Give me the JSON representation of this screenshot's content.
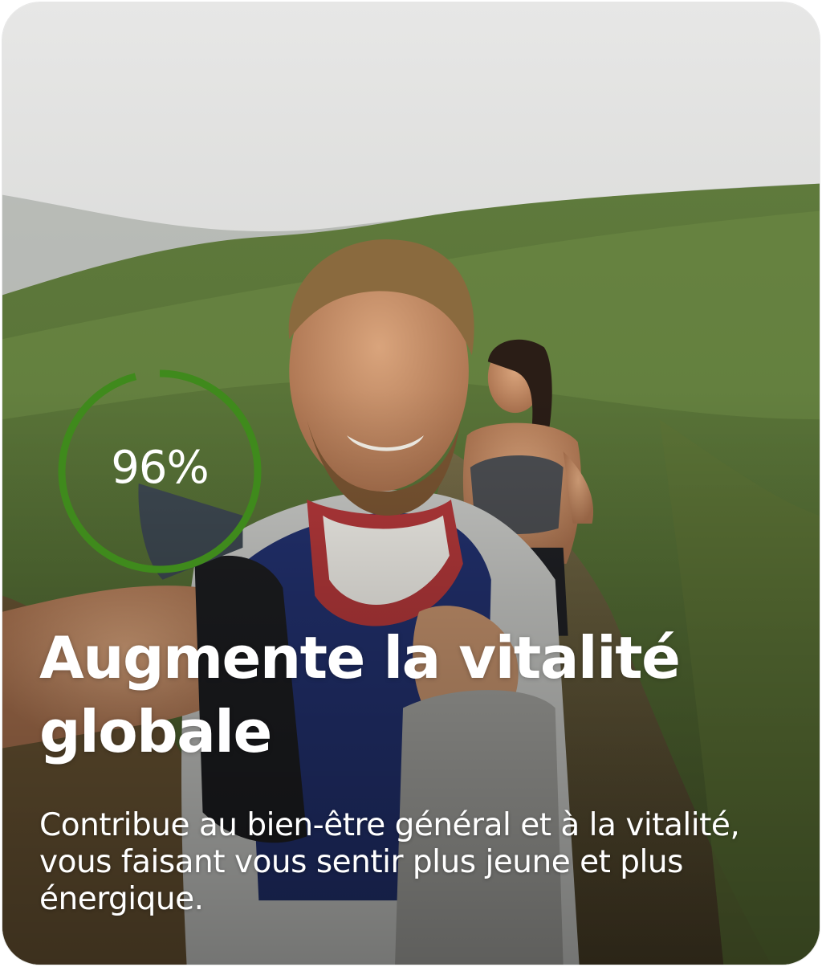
{
  "card": {
    "progress": {
      "value": 0.96,
      "label": "96%",
      "ring_color": "#3f8a1c"
    },
    "title": "Augmente la vitalité globale",
    "description": "Contribue au bien-être général et à la vitalité, vous faisant vous sentir plus jeune et plus énergique."
  }
}
